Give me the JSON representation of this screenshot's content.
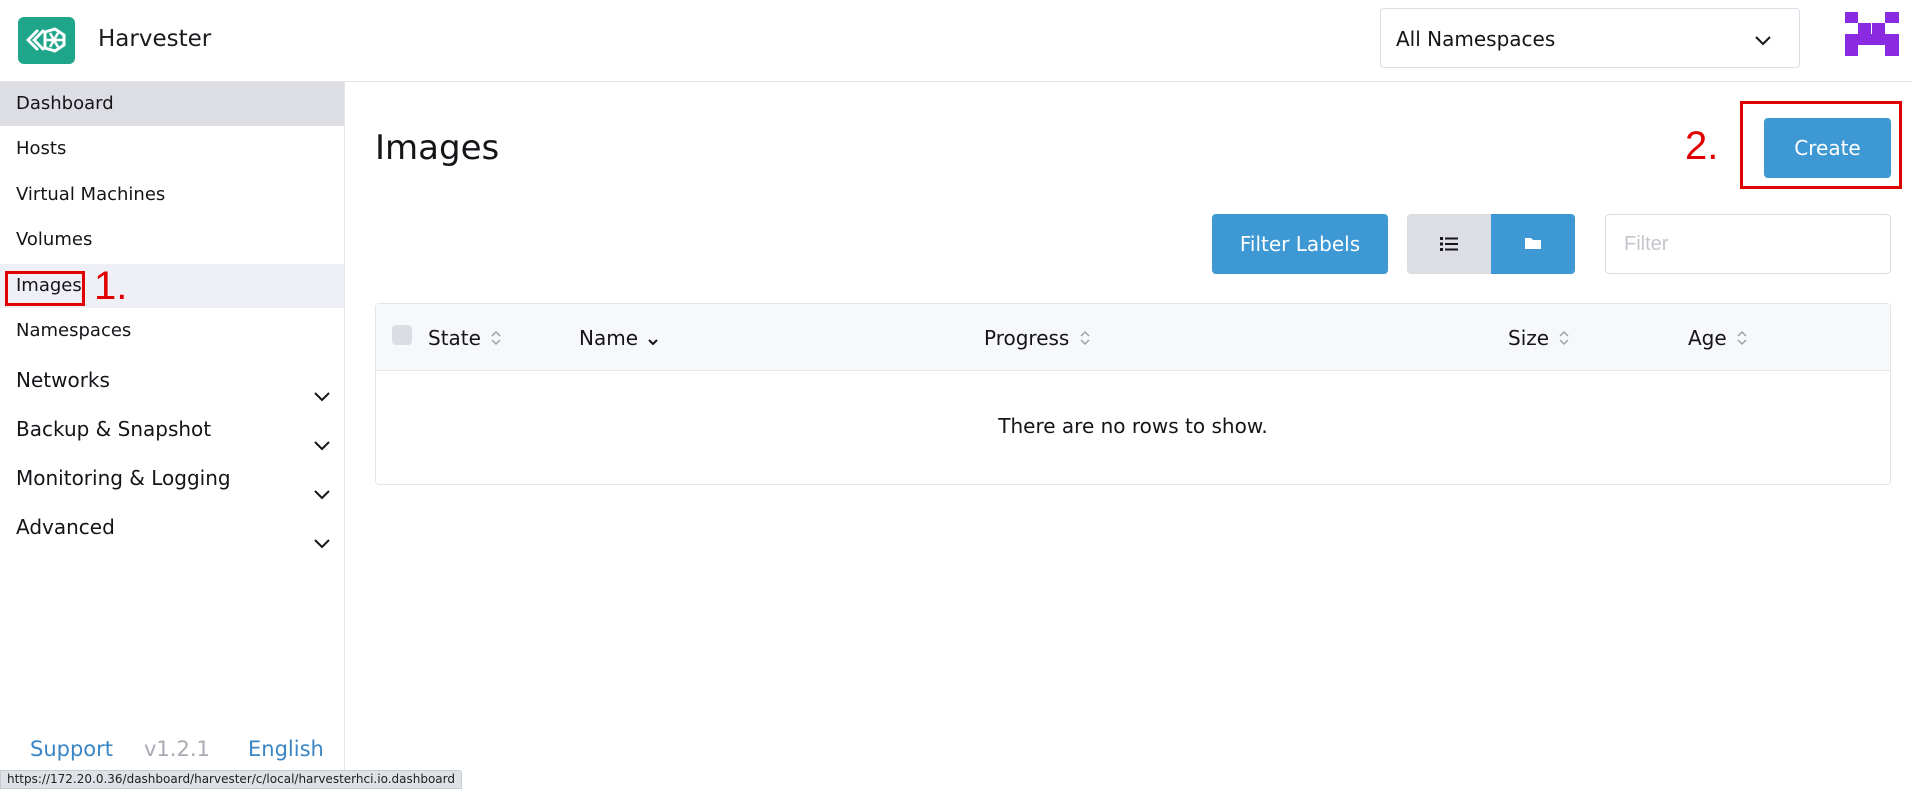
{
  "header": {
    "brand": "Harvester",
    "namespace_selected": "All Namespaces"
  },
  "sidebar": {
    "items": [
      {
        "label": "Dashboard"
      },
      {
        "label": "Hosts"
      },
      {
        "label": "Virtual Machines"
      },
      {
        "label": "Volumes"
      },
      {
        "label": "Images"
      },
      {
        "label": "Namespaces"
      }
    ],
    "groups": [
      {
        "label": "Networks"
      },
      {
        "label": "Backup & Snapshot"
      },
      {
        "label": "Monitoring & Logging"
      },
      {
        "label": "Advanced"
      }
    ],
    "footer": {
      "support": "Support",
      "version": "v1.2.1",
      "language": "English"
    }
  },
  "annotations": {
    "step1": "1.",
    "step2": "2."
  },
  "main": {
    "title": "Images",
    "create_label": "Create",
    "filter_labels": "Filter Labels",
    "filter_placeholder": "Filter",
    "table": {
      "columns": [
        "State",
        "Name",
        "Progress",
        "Size",
        "Age"
      ],
      "empty_message": "There are no rows to show."
    }
  },
  "status_bar": {
    "url": "https://172.20.0.36/dashboard/harvester/c/local/harvesterhci.io.dashboard"
  },
  "colors": {
    "accent": "#3d98d3",
    "brand_green": "#1ea58a",
    "annotation_red": "#e00000"
  },
  "icons": {
    "logo": "harvester-logo-icon",
    "namespace_dropdown": "chevron-down-icon",
    "avatar": "user-avatar-icon",
    "list_view": "list-icon",
    "folder_view": "folder-icon",
    "sort": "sort-icon"
  }
}
